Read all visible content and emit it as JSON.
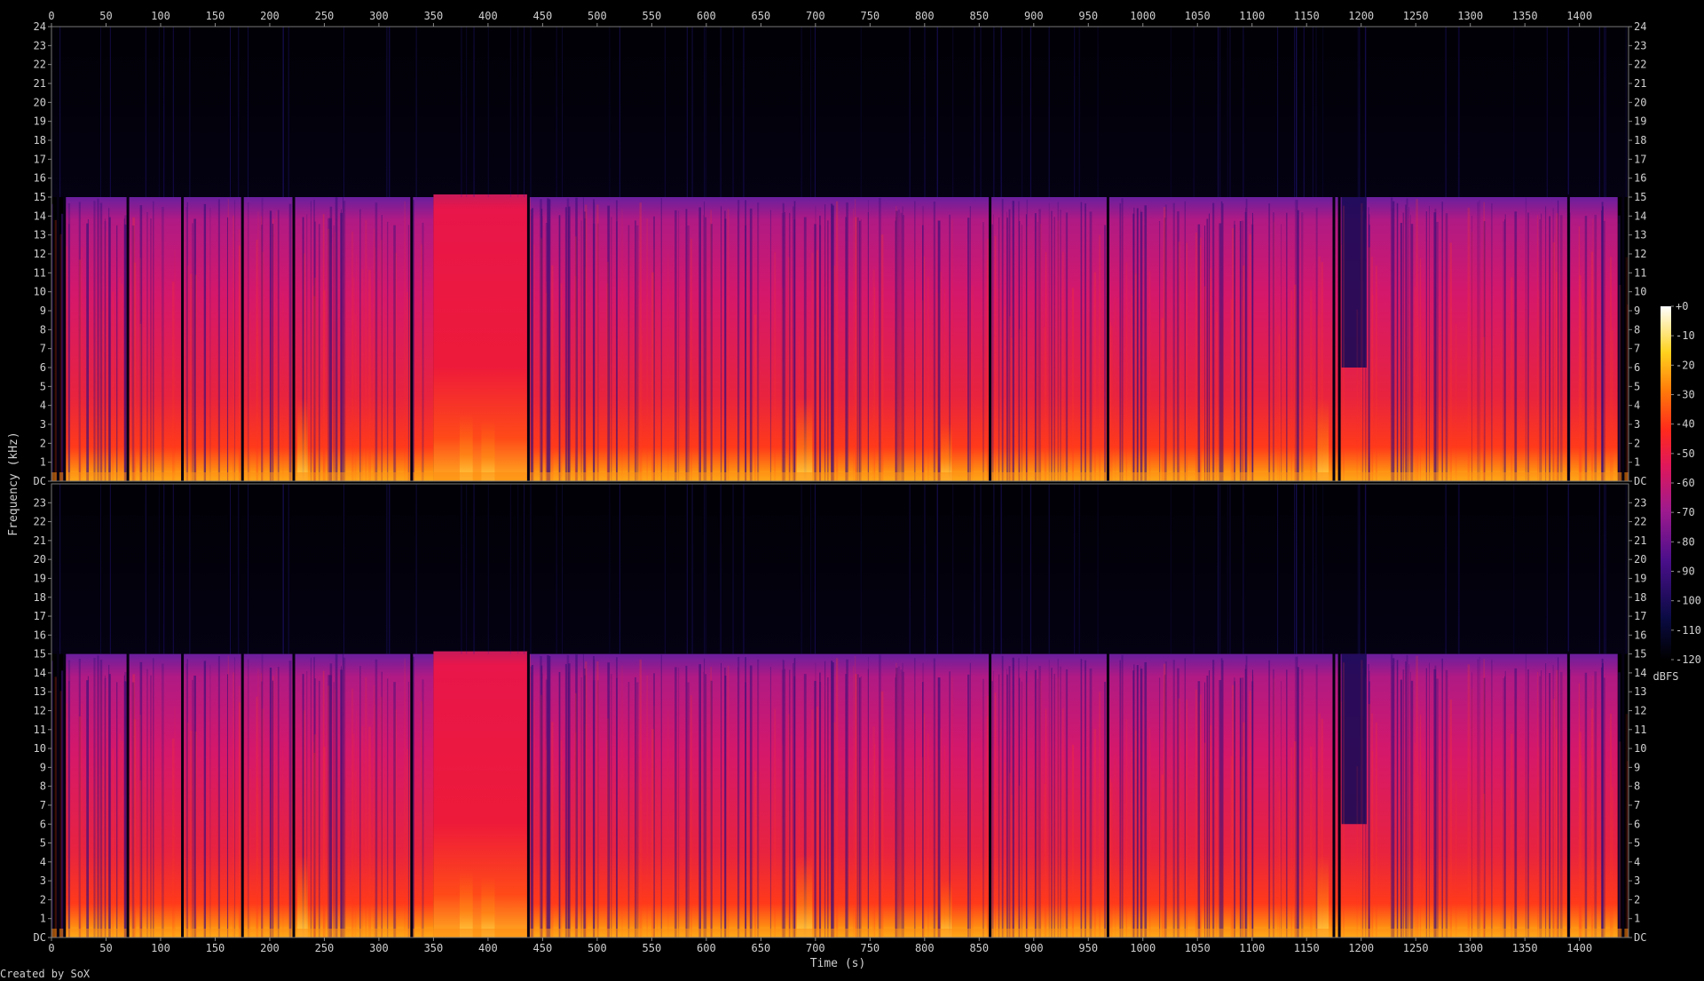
{
  "chart_data": {
    "type": "heatmap",
    "subtype": "spectrogram",
    "channels": 2,
    "xlabel": "Time (s)",
    "ylabel": "Frequency (kHz)",
    "xlim": [
      0,
      1445
    ],
    "ylim_khz": [
      0,
      24
    ],
    "x_ticks": [
      0,
      50,
      100,
      150,
      200,
      250,
      300,
      350,
      400,
      450,
      500,
      550,
      600,
      650,
      700,
      750,
      800,
      850,
      900,
      950,
      1000,
      1050,
      1100,
      1150,
      1200,
      1250,
      1300,
      1350,
      1400
    ],
    "y_tick_labels": [
      "DC",
      "1",
      "2",
      "3",
      "4",
      "5",
      "6",
      "7",
      "8",
      "9",
      "10",
      "11",
      "12",
      "13",
      "14",
      "15",
      "16",
      "17",
      "18",
      "19",
      "20",
      "21",
      "22",
      "23",
      "24"
    ],
    "colorbar": {
      "unit": "dBFS",
      "range": [
        -120,
        0
      ],
      "tick_labels": [
        "+0",
        "-10",
        "-20",
        "-30",
        "-40",
        "-50",
        "-60",
        "-70",
        "-80",
        "-90",
        "-100",
        "-110",
        "-120"
      ]
    },
    "spectral_profile": {
      "bandwidth_cutoff_khz": 15,
      "dense_segment_s": [
        350,
        437
      ],
      "dropout_times_s": [
        6,
        12,
        70,
        120,
        175,
        222,
        330,
        437,
        860,
        968,
        1175,
        1180,
        1390,
        1440
      ],
      "quiet_band_s": [
        1182,
        1205
      ],
      "bright_low_freq_times_s": [
        230,
        380,
        400,
        690,
        820,
        1165
      ]
    },
    "footer": "Created by SoX"
  }
}
